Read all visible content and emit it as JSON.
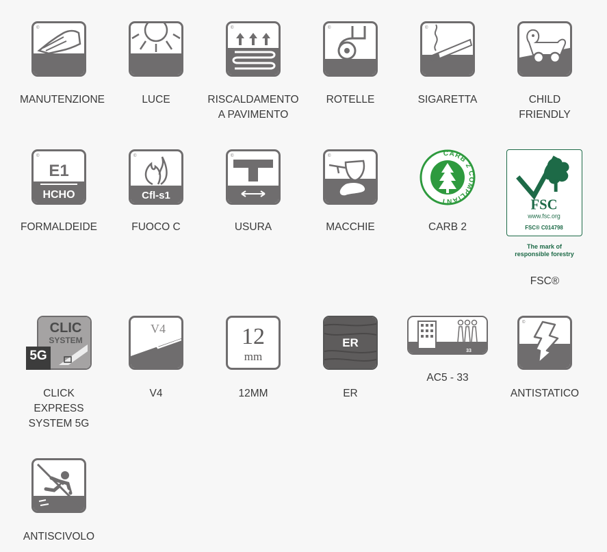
{
  "items": [
    {
      "icon": "hand-icon",
      "label": "MANUTENZIONE"
    },
    {
      "icon": "sun-icon",
      "label": "LUCE"
    },
    {
      "icon": "floor-heating-icon",
      "label": "RISCALDAMENTO\nA PAVIMENTO"
    },
    {
      "icon": "caster-icon",
      "label": "ROTELLE"
    },
    {
      "icon": "cigarette-icon",
      "label": "SIGARETTA"
    },
    {
      "icon": "toy-dog-icon",
      "label": "CHILD\nFRIENDLY"
    },
    {
      "icon": "formaldehyde-icon",
      "label": "FORMALDEIDE",
      "icon_text": [
        "E1",
        "HCHO"
      ]
    },
    {
      "icon": "fire-icon",
      "label": "FUOCO C",
      "icon_text": [
        "Cfl-s1"
      ]
    },
    {
      "icon": "wear-icon",
      "label": "USURA"
    },
    {
      "icon": "stain-glass-icon",
      "label": "MACCHIE"
    },
    {
      "icon": "carb2-seal-icon",
      "label": "CARB 2",
      "icon_text": [
        "CARB 2 COMPLIANT"
      ]
    },
    {
      "icon": "fsc-logo-icon",
      "label": "FSC®",
      "icon_text": [
        "FSC",
        "www.fsc.org",
        "FSC® C014798",
        "The mark of",
        "responsible forestry"
      ]
    },
    {
      "icon": "clic-system-icon",
      "label": "CLICK\nEXPRESS\nSYSTEM 5G",
      "icon_text": [
        "CLIC",
        "SYSTEM",
        "5G"
      ]
    },
    {
      "icon": "v4-bevel-icon",
      "label": "V4",
      "icon_text": [
        "V4"
      ]
    },
    {
      "icon": "thickness-icon",
      "label": "12MM",
      "icon_text": [
        "12",
        "mm"
      ]
    },
    {
      "icon": "er-texture-icon",
      "label": "ER",
      "icon_text": [
        "ER"
      ]
    },
    {
      "icon": "ac5-class-icon",
      "label": "AC5 - 33",
      "icon_text": [
        "33"
      ]
    },
    {
      "icon": "antistatic-icon",
      "label": "ANTISTATICO"
    },
    {
      "icon": "anti-slip-icon",
      "label": "ANTISCIVOLO"
    }
  ],
  "colors": {
    "icon_gray": "#6f6d6e",
    "carb_green": "#2e9a3e",
    "fsc_green": "#1d6a47",
    "text": "#3a3a3a",
    "background": "#f7f7f7"
  }
}
